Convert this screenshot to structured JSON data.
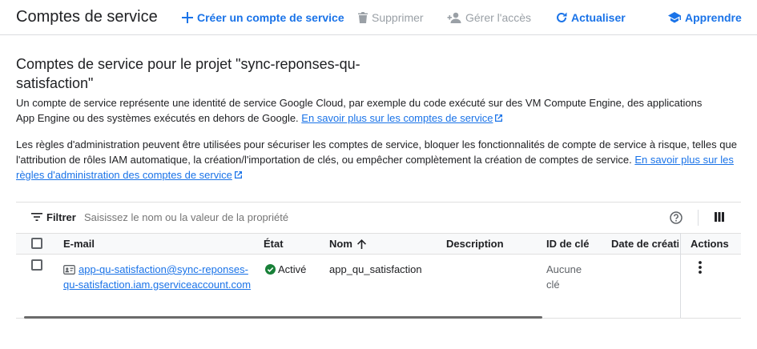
{
  "header": {
    "title": "Comptes de service",
    "create_label": "Créer un compte de service",
    "delete_label": "Supprimer",
    "manage_label": "Gérer l'accès",
    "refresh_label": "Actualiser",
    "learn_label": "Apprendre"
  },
  "main": {
    "section_title": "Comptes de service pour le projet \"sync-reponses-qu-satisfaction\"",
    "para1_text": "Un compte de service représente une identité de service Google Cloud, par exemple du code exécuté sur des VM Compute Engine, des applications App Engine ou des systèmes exécutés en dehors de Google. ",
    "para1_link": "En savoir plus sur les comptes de service",
    "para2_text": "Les règles d'administration peuvent être utilisées pour sécuriser les comptes de service, bloquer les fonctionnalités de compte de service à risque, telles que l'attribution de rôles IAM automatique, la création/l'importation de clés, ou empêcher complètement la création de comptes de service. ",
    "para2_link": "En savoir plus sur les règles d'administration des comptes de service"
  },
  "table": {
    "filter_label": "Filtrer",
    "filter_placeholder": "Saisissez le nom ou la valeur de la propriété",
    "columns": {
      "email": "E-mail",
      "status": "État",
      "name": "Nom",
      "description": "Description",
      "key_id": "ID de clé",
      "created": "Date de création",
      "actions": "Actions"
    },
    "rows": [
      {
        "email": "app-qu-satisfaction@sync-reponses-qu-satisfaction.iam.gserviceaccount.com",
        "status": "Activé",
        "name": "app_qu_satisfaction",
        "description": "",
        "key_id": "Aucune clé"
      }
    ]
  },
  "colors": {
    "accent": "#1a73e8",
    "disabled": "#9aa0a6",
    "success": "#188038",
    "text": "#202124"
  }
}
